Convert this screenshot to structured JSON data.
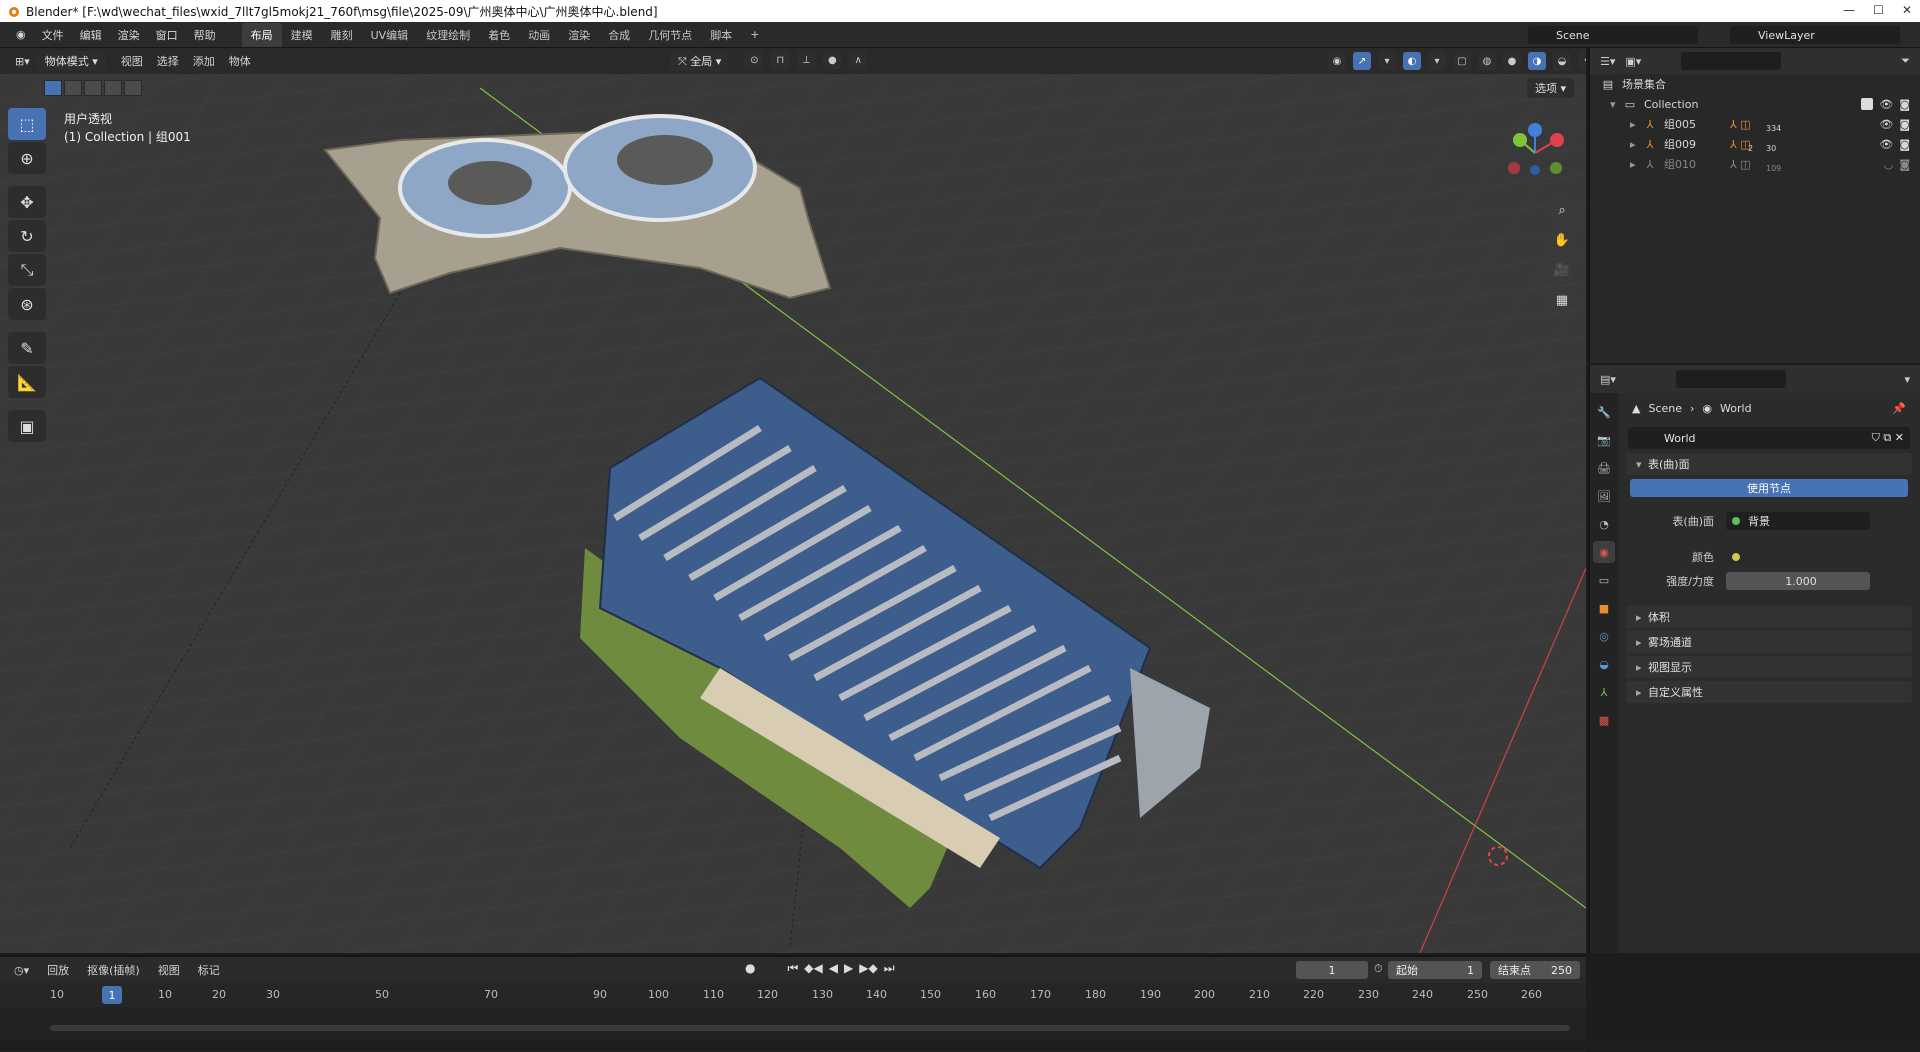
{
  "window": {
    "title": "Blender* [F:\\wd\\wechat_files\\wxid_7llt7gl5mokj21_760f\\msg\\file\\2025-09\\广州奥体中心\\广州奥体中心.blend]"
  },
  "menu": {
    "items": [
      "文件",
      "编辑",
      "渲染",
      "窗口",
      "帮助"
    ]
  },
  "workspaces": {
    "items": [
      "布局",
      "建模",
      "雕刻",
      "UV编辑",
      "纹理绘制",
      "着色",
      "动画",
      "渲染",
      "合成",
      "几何节点",
      "脚本"
    ],
    "active": "布局",
    "add": "+"
  },
  "scene": {
    "name": "Scene"
  },
  "viewlayer": {
    "name": "ViewLayer"
  },
  "viewport": {
    "mode": "物体模式",
    "menus": [
      "视图",
      "选择",
      "添加",
      "物体"
    ],
    "transform_orientation": "全局",
    "options": "选项",
    "view_name": "用户透视",
    "collection_info": "(1) Collection | 组001"
  },
  "outliner": {
    "root": "场景集合",
    "collection": "Collection",
    "items": [
      {
        "name": "组005",
        "badge": "334",
        "dim": false
      },
      {
        "name": "组009",
        "badge": "30",
        "sub": "2",
        "dim": false
      },
      {
        "name": "组010",
        "badge": "109",
        "dim": true
      }
    ]
  },
  "properties": {
    "breadcrumb_scene": "Scene",
    "breadcrumb_world": "World",
    "world_name": "World",
    "surface_panel": "表(曲)面",
    "use_nodes": "使用节点",
    "surface_label": "表(曲)面",
    "surface_value": "背景",
    "color_label": "颜色",
    "strength_label": "强度/力度",
    "strength_value": "1.000",
    "panels": [
      "体积",
      "雾场通道",
      "视图显示",
      "自定义属性"
    ]
  },
  "timeline": {
    "menus": [
      "回放",
      "抠像(插帧)",
      "视图",
      "标记"
    ],
    "current_frame": "1",
    "start_label": "起始",
    "start_value": "1",
    "end_label": "结束点",
    "end_value": "250",
    "ruler": [
      "10",
      "1",
      "10",
      "20",
      "30",
      "50",
      "70",
      "90",
      "100",
      "110",
      "120",
      "130",
      "140",
      "150",
      "160",
      "170",
      "180",
      "190",
      "200",
      "210",
      "220",
      "230",
      "240",
      "250",
      "260"
    ]
  },
  "colors": {
    "accent": "#4772b3",
    "x_axis": "#e0414e",
    "y_axis": "#80c43c",
    "z_axis": "#3f82de"
  }
}
